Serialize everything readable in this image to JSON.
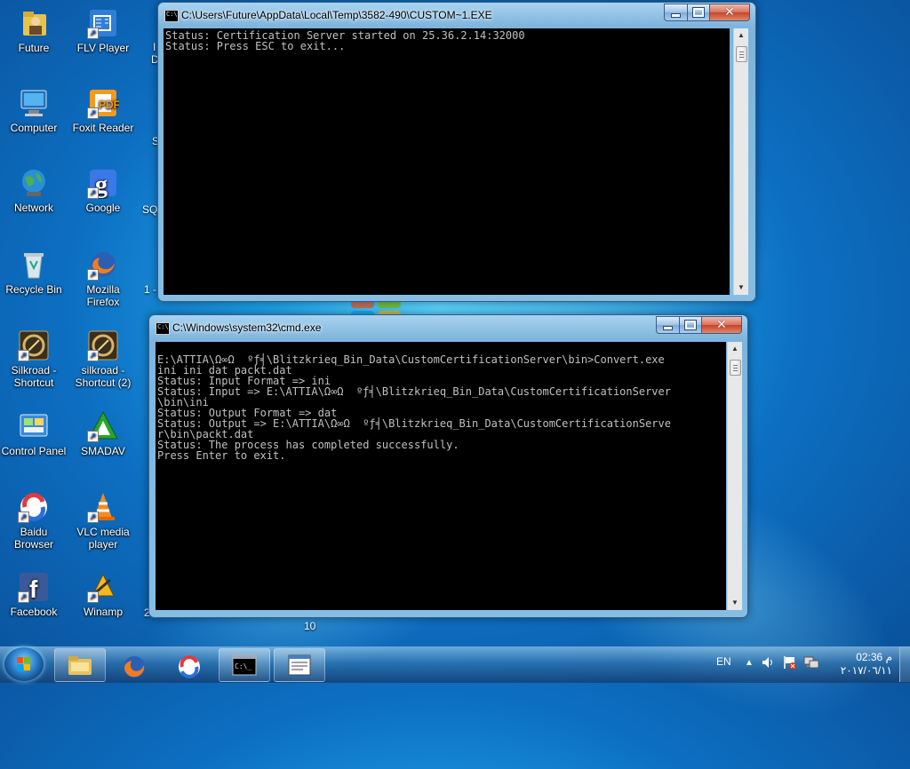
{
  "desktop": {
    "icons": [
      {
        "label": "Future"
      },
      {
        "label": "FLV Player"
      },
      {
        "label": "Computer"
      },
      {
        "label": "Foxit Reader"
      },
      {
        "label": "Network"
      },
      {
        "label": "Google"
      },
      {
        "label": "Recycle Bin"
      },
      {
        "label": "Mozilla Firefox"
      },
      {
        "label": "Silkroad - Shortcut"
      },
      {
        "label": "silkroad - Shortcut (2)"
      },
      {
        "label": "Control Panel"
      },
      {
        "label": "SMADAV"
      },
      {
        "label": "Baidu Browser"
      },
      {
        "label": "VLC media player"
      },
      {
        "label": "Facebook"
      },
      {
        "label": "Winamp"
      }
    ],
    "edge_texts": [
      "I",
      "D",
      "S",
      "SQ",
      "1 -",
      "2",
      "10"
    ]
  },
  "window_server": {
    "title": "C:\\Users\\Future\\AppData\\Local\\Temp\\3582-490\\CUSTOM~1.EXE",
    "lines": [
      "Status: Certification Server started on 25.36.2.14:32000",
      "Status: Press ESC to exit..."
    ]
  },
  "window_cmd": {
    "title": "C:\\Windows\\system32\\cmd.exe",
    "lines": [
      "E:\\ATTIA\\Ω∞Ω  ºƒ╡\\Blitzkrieq_Bin_Data\\CustomCertificationServer\\bin>Convert.exe",
      "ini ini dat packt.dat",
      "Status: Input Format => ini",
      "Status: Input => E:\\ATTIA\\Ω∞Ω  ºƒ╡\\Blitzkrieq_Bin_Data\\CustomCertificationServer",
      "\\bin\\ini",
      "Status: Output Format => dat",
      "Status: Output => E:\\ATTIA\\Ω∞Ω  ºƒ╡\\Blitzkrieq_Bin_Data\\CustomCertificationServe",
      "r\\bin\\packt.dat",
      "Status: The process has completed successfully.",
      "Press Enter to exit."
    ]
  },
  "taskbar": {
    "language": "EN",
    "time": "02:36 م",
    "date": "٢٠١٧/٠٦/١١"
  },
  "colors": {
    "console_bg": "#000000",
    "console_fg": "#c0c0c0",
    "close_red": "#c5432a",
    "frame_blue": "#87bde3"
  },
  "icons": {
    "start": "windows-flag-icon",
    "explorer": "folder-icon",
    "firefox": "firefox-icon",
    "baidu": "baidu-browser-icon",
    "cmd": "command-prompt-icon",
    "app": "window-app-icon"
  }
}
